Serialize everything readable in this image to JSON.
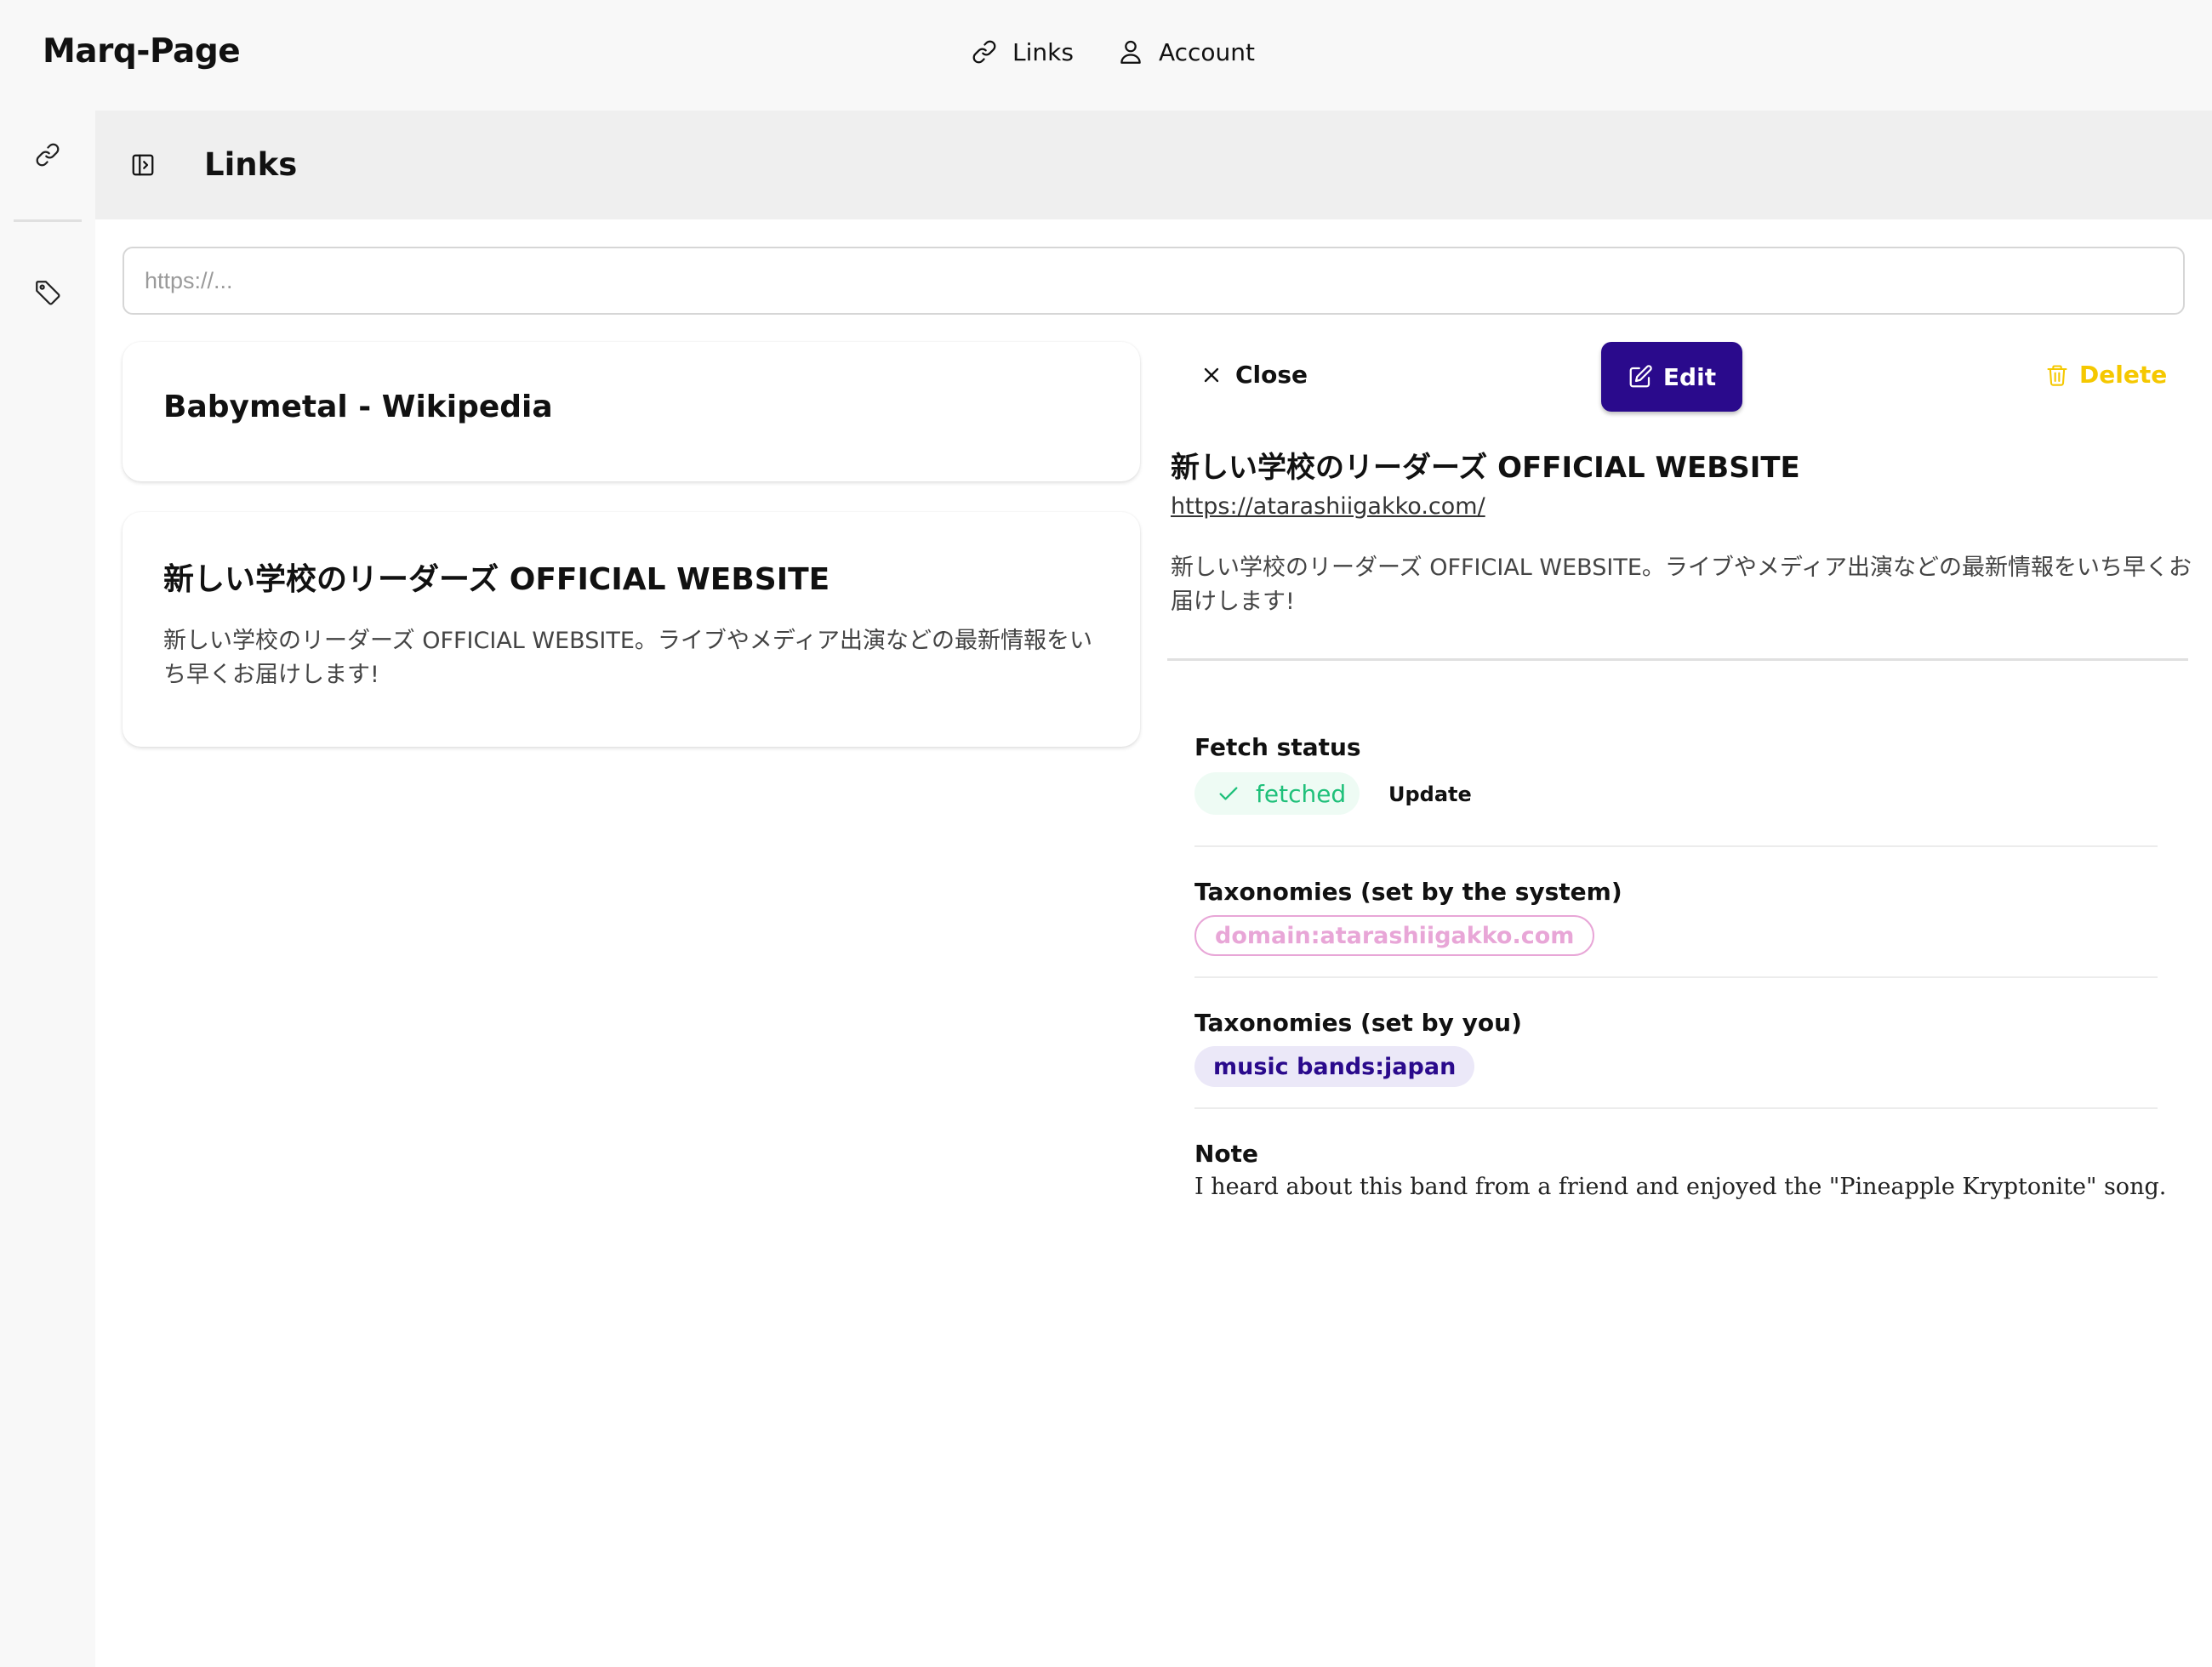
{
  "app": {
    "brand": "Marq-Page"
  },
  "topnav": {
    "links_label": "Links",
    "account_label": "Account"
  },
  "rail": {
    "items": [
      "link-icon",
      "tag-icon"
    ]
  },
  "header": {
    "title": "Links"
  },
  "search": {
    "placeholder": "https://..."
  },
  "cards": [
    {
      "title": "Babymetal - Wikipedia",
      "description": ""
    },
    {
      "title": "新しい学校のリーダーズ OFFICIAL WEBSITE",
      "description": "新しい学校のリーダーズ OFFICIAL WEBSITE。ライブやメディア出演などの最新情報をいち早くお届けします!"
    }
  ],
  "detail": {
    "close_label": "Close",
    "edit_label": "Edit",
    "delete_label": "Delete",
    "title": "新しい学校のリーダーズ OFFICIAL WEBSITE",
    "url": "https://atarashiigakko.com/",
    "description": "新しい学校のリーダーズ OFFICIAL WEBSITE。ライブやメディア出演などの最新情報をいち早くお届けします!",
    "fetch_status_label": "Fetch status",
    "fetch_status": "fetched",
    "update_label": "Update",
    "taxonomies_system_label": "Taxonomies (set by the system)",
    "taxonomies_system": [
      "domain:atarashiigakko.com"
    ],
    "taxonomies_user_label": "Taxonomies (set by you)",
    "taxonomies_user": [
      "music bands:japan"
    ],
    "note_label": "Note",
    "note": "I heard about this band from a friend and enjoyed the \"Pineapple Kryptonite\" song."
  },
  "colors": {
    "accent": "#2a0a8c",
    "delete": "#f5c800",
    "status_ok": "#1fc07a",
    "tag_system": "#e8a6d7",
    "tag_user_bg": "#ebe8f8"
  }
}
